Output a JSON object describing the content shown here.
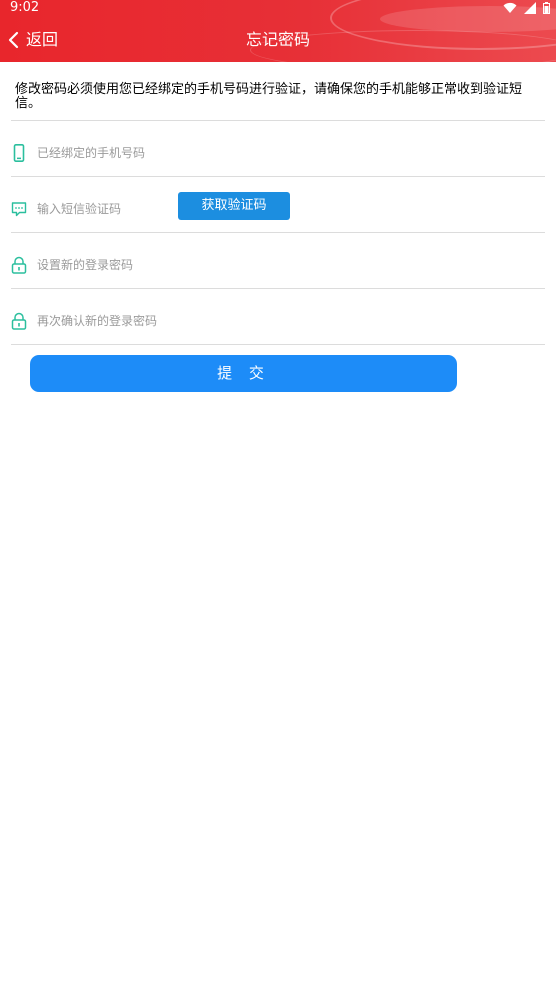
{
  "status_bar": {
    "time": "9:02",
    "icons": [
      "wifi-icon",
      "signal-icon",
      "battery-icon"
    ]
  },
  "header": {
    "back_label": "返回",
    "title": "忘记密码"
  },
  "notice": "修改密码必须使用您已经绑定的手机号码进行验证，请确保您的手机能够正常收到验证短信。",
  "form": {
    "phone_placeholder": "已经绑定的手机号码",
    "sms_placeholder": "输入短信验证码",
    "get_code_label": "获取验证码",
    "new_password_placeholder": "设置新的登录密码",
    "confirm_password_placeholder": "再次确认新的登录密码",
    "submit_label": "提 交"
  },
  "colors": {
    "header_red": "#e8262c",
    "icon_green": "#2bbf9e",
    "button_blue": "#1d8cf8",
    "code_button_blue": "#1c8ee0"
  }
}
